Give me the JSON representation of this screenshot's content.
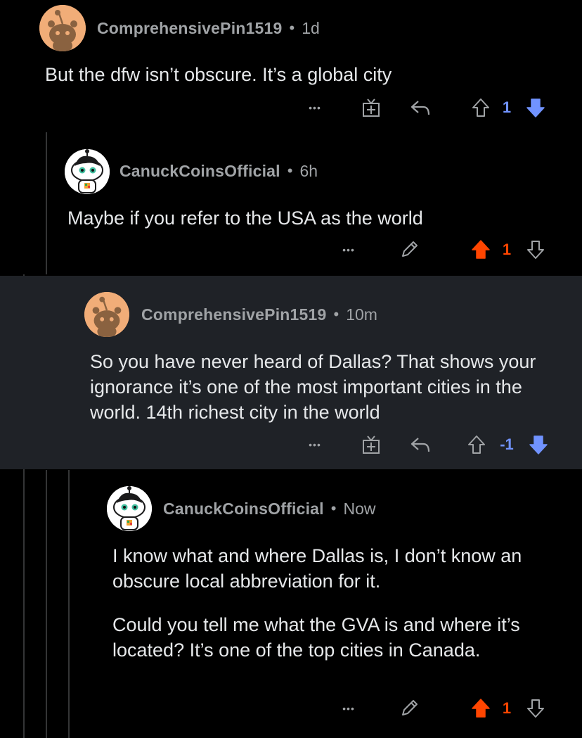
{
  "comments": [
    {
      "author": "ComprehensivePin1519",
      "age": "1d",
      "paragraphs": [
        "But the dfw isn’t obscure. It’s a global city"
      ],
      "score": "1",
      "vote": "down",
      "actions": [
        "more",
        "award",
        "reply"
      ]
    },
    {
      "author": "CanuckCoinsOfficial",
      "age": "6h",
      "paragraphs": [
        "Maybe if you refer to the USA as the world"
      ],
      "score": "1",
      "vote": "up",
      "actions": [
        "more",
        "edit"
      ]
    },
    {
      "author": "ComprehensivePin1519",
      "age": "10m",
      "paragraphs": [
        "So you have never heard of Dallas? That shows your ignorance it’s one of the most important cities in the world. 14th richest city in the world"
      ],
      "score": "-1",
      "vote": "down",
      "highlighted": true,
      "actions": [
        "more",
        "award",
        "reply"
      ]
    },
    {
      "author": "CanuckCoinsOfficial",
      "age": "Now",
      "paragraphs": [
        "I know what and where Dallas is, I don’t know an obscure local abbreviation for it.",
        "Could you tell me what the GVA is and where it’s located? It’s one of the top cities in Canada."
      ],
      "score": "1",
      "vote": "up",
      "actions": [
        "more",
        "edit"
      ]
    }
  ],
  "separator": "•",
  "more_glyph": "•••",
  "colors": {
    "background": "#000000",
    "highlight": "#1f2227",
    "upvote": "#ff4500",
    "downvote": "#7193ff",
    "meta": "#a0a3a6",
    "text": "#e6e8ea"
  }
}
